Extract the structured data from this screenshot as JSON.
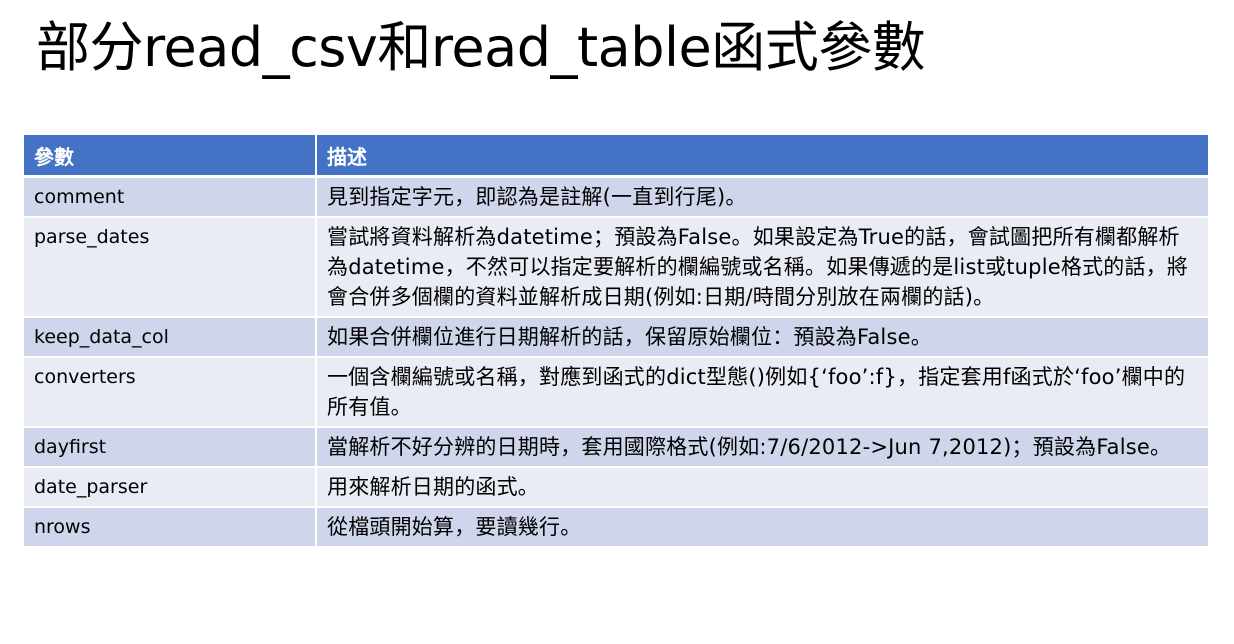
{
  "title": "部分read_csv和read_table函式參數",
  "table": {
    "headers": [
      "參數",
      "描述"
    ],
    "rows": [
      {
        "name": "comment",
        "desc": "見到指定字元，即認為是註解(一直到行尾)。"
      },
      {
        "name": "parse_dates",
        "desc": "嘗試將資料解析為datetime；預設為False。如果設定為True的話，會試圖把所有欄都解析為datetime，不然可以指定要解析的欄編號或名稱。如果傳遞的是list或tuple格式的話，將會合併多個欄的資料並解析成日期(例如:日期/時間分別放在兩欄的話)。"
      },
      {
        "name": "keep_data_col",
        "desc": "如果合併欄位進行日期解析的話，保留原始欄位：預設為False。"
      },
      {
        "name": "converters",
        "desc": "一個含欄編號或名稱，對應到函式的dict型態()例如{‘foo’:f}，指定套用f函式於‘foo’欄中的所有值。"
      },
      {
        "name": "dayfirst",
        "desc": "當解析不好分辨的日期時，套用國際格式(例如:7/6/2012->Jun 7,2012)；預設為False。"
      },
      {
        "name": "date_parser",
        "desc": "用來解析日期的函式。"
      },
      {
        "name": "nrows",
        "desc": "從檔頭開始算，要讀幾行。"
      }
    ]
  }
}
